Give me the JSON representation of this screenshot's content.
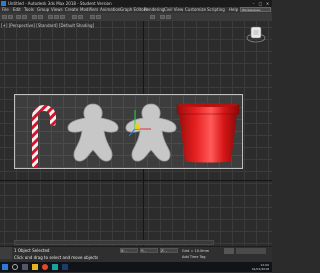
{
  "app": {
    "title": "Untitled - Autodesk 3ds Max 2018 - Student Version",
    "workspace": "Workspaces: Default"
  },
  "menu": [
    "File",
    "Edit",
    "Tools",
    "Group",
    "Views",
    "Create",
    "Modifiers",
    "Animation",
    "Graph Editors",
    "Rendering",
    "Civil View",
    "Customize",
    "Scripting",
    "Help"
  ],
  "viewport": {
    "label": "[+] [Perspective] [Standard] [Default Shading]"
  },
  "scene": {
    "objects": [
      "candy-cane",
      "gingerbread-man-left",
      "gingerbread-man-right",
      "red-mug"
    ]
  },
  "status": {
    "selection": "1 Object Selected",
    "hint": "Click and drag to select and move objects",
    "coords": {
      "x": "X: -",
      "y": "Y: -",
      "z": "Z: -"
    },
    "grid": "Grid = 10.0mm",
    "time_tag": "Add Time Tag"
  },
  "taskbar": {
    "time": "12:00",
    "date": "01/01/2018"
  },
  "colors": {
    "accent": "#2a7bd4",
    "mug": "#d81818",
    "cane_red": "#d4132a"
  }
}
